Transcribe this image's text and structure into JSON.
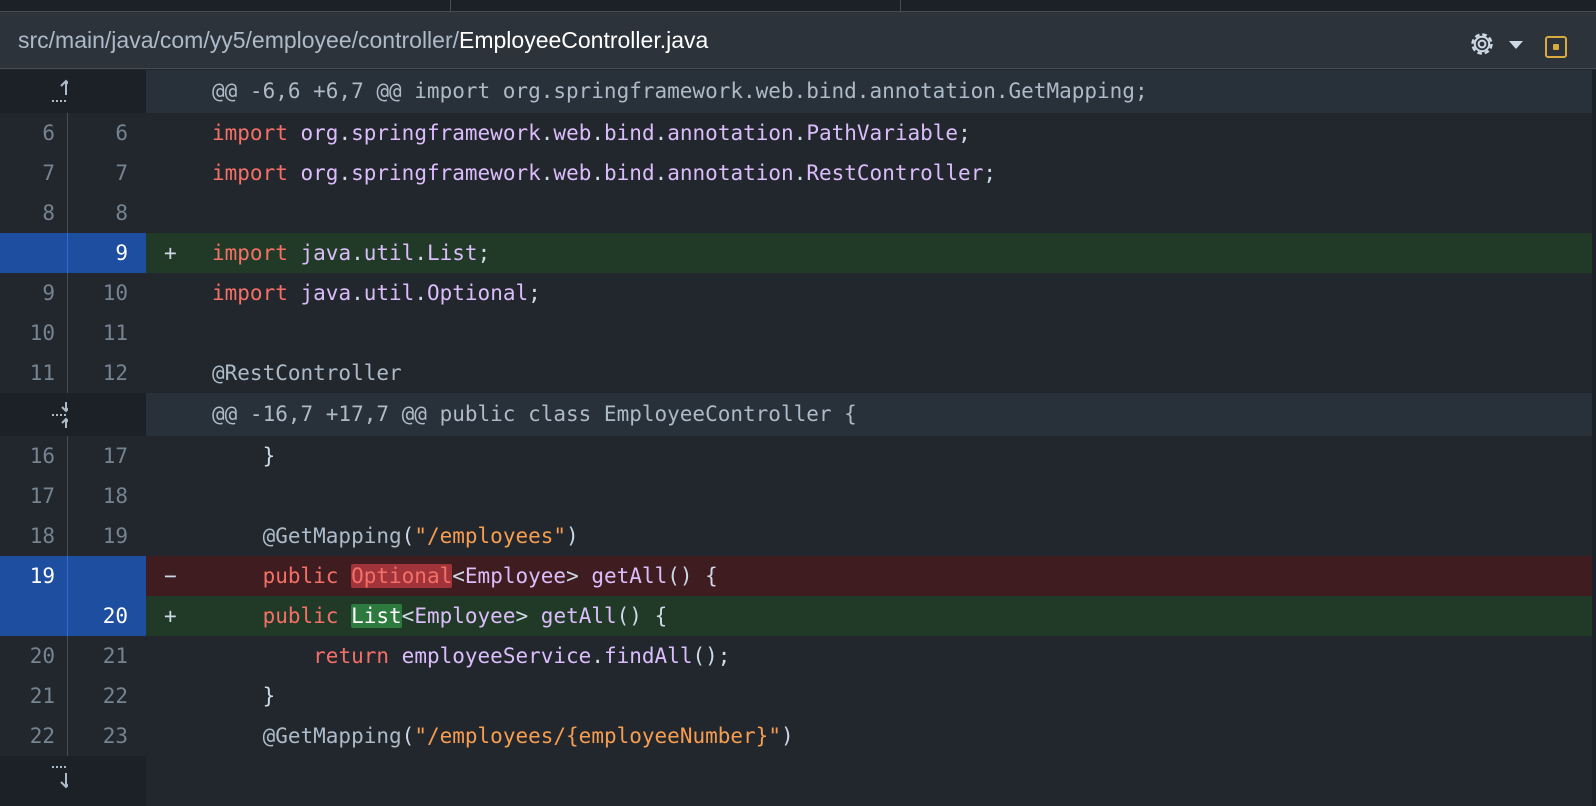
{
  "header": {
    "path_dir": "src/main/java/com/yy5/employee/controller/",
    "file_name": "EmployeeController.java",
    "settings_icon": "gear-icon",
    "view_icon": "view-file-icon",
    "accent_color": "#daaa3f"
  },
  "hunks": [
    {
      "header": "@@ -6,6 +6,7 @@ import org.springframework.web.bind.annotation.GetMapping;"
    },
    {
      "header": "@@ -16,7 +17,7 @@ public class EmployeeController {"
    }
  ],
  "lines": [
    {
      "old": "6",
      "new": "6",
      "marker": "",
      "type": "ctx"
    },
    {
      "old": "7",
      "new": "7",
      "marker": "",
      "type": "ctx"
    },
    {
      "old": "8",
      "new": "8",
      "marker": "",
      "type": "ctx"
    },
    {
      "old": "",
      "new": "9",
      "marker": "+",
      "type": "add"
    },
    {
      "old": "9",
      "new": "10",
      "marker": "",
      "type": "ctx"
    },
    {
      "old": "10",
      "new": "11",
      "marker": "",
      "type": "ctx"
    },
    {
      "old": "11",
      "new": "12",
      "marker": "",
      "type": "ctx"
    },
    {
      "old": "16",
      "new": "17",
      "marker": "",
      "type": "ctx"
    },
    {
      "old": "17",
      "new": "18",
      "marker": "",
      "type": "ctx"
    },
    {
      "old": "18",
      "new": "19",
      "marker": "",
      "type": "ctx"
    },
    {
      "old": "19",
      "new": "",
      "marker": "−",
      "type": "del"
    },
    {
      "old": "",
      "new": "20",
      "marker": "+",
      "type": "add"
    },
    {
      "old": "20",
      "new": "21",
      "marker": "",
      "type": "ctx"
    },
    {
      "old": "21",
      "new": "22",
      "marker": "",
      "type": "ctx"
    },
    {
      "old": "22",
      "new": "23",
      "marker": "",
      "type": "ctx"
    }
  ],
  "tokens": {
    "import": "import",
    "org": "org",
    "springframework": "springframework",
    "web": "web",
    "bind": "bind",
    "annotation": "annotation",
    "PathVariable": "PathVariable",
    "RestController": "RestController",
    "java": "java",
    "util": "util",
    "List": "List",
    "Optional": "Optional",
    "at_RestController": "@RestController",
    "brace_close": "}",
    "at_GetMapping": "@GetMapping",
    "path_employees": "\"/employees\"",
    "path_employee_number": "\"/employees/{employeeNumber}\"",
    "public": "public",
    "Employee": "Employee",
    "getAll": "getAll",
    "return": "return",
    "employeeService": "employeeService",
    "findAll": "findAll"
  }
}
